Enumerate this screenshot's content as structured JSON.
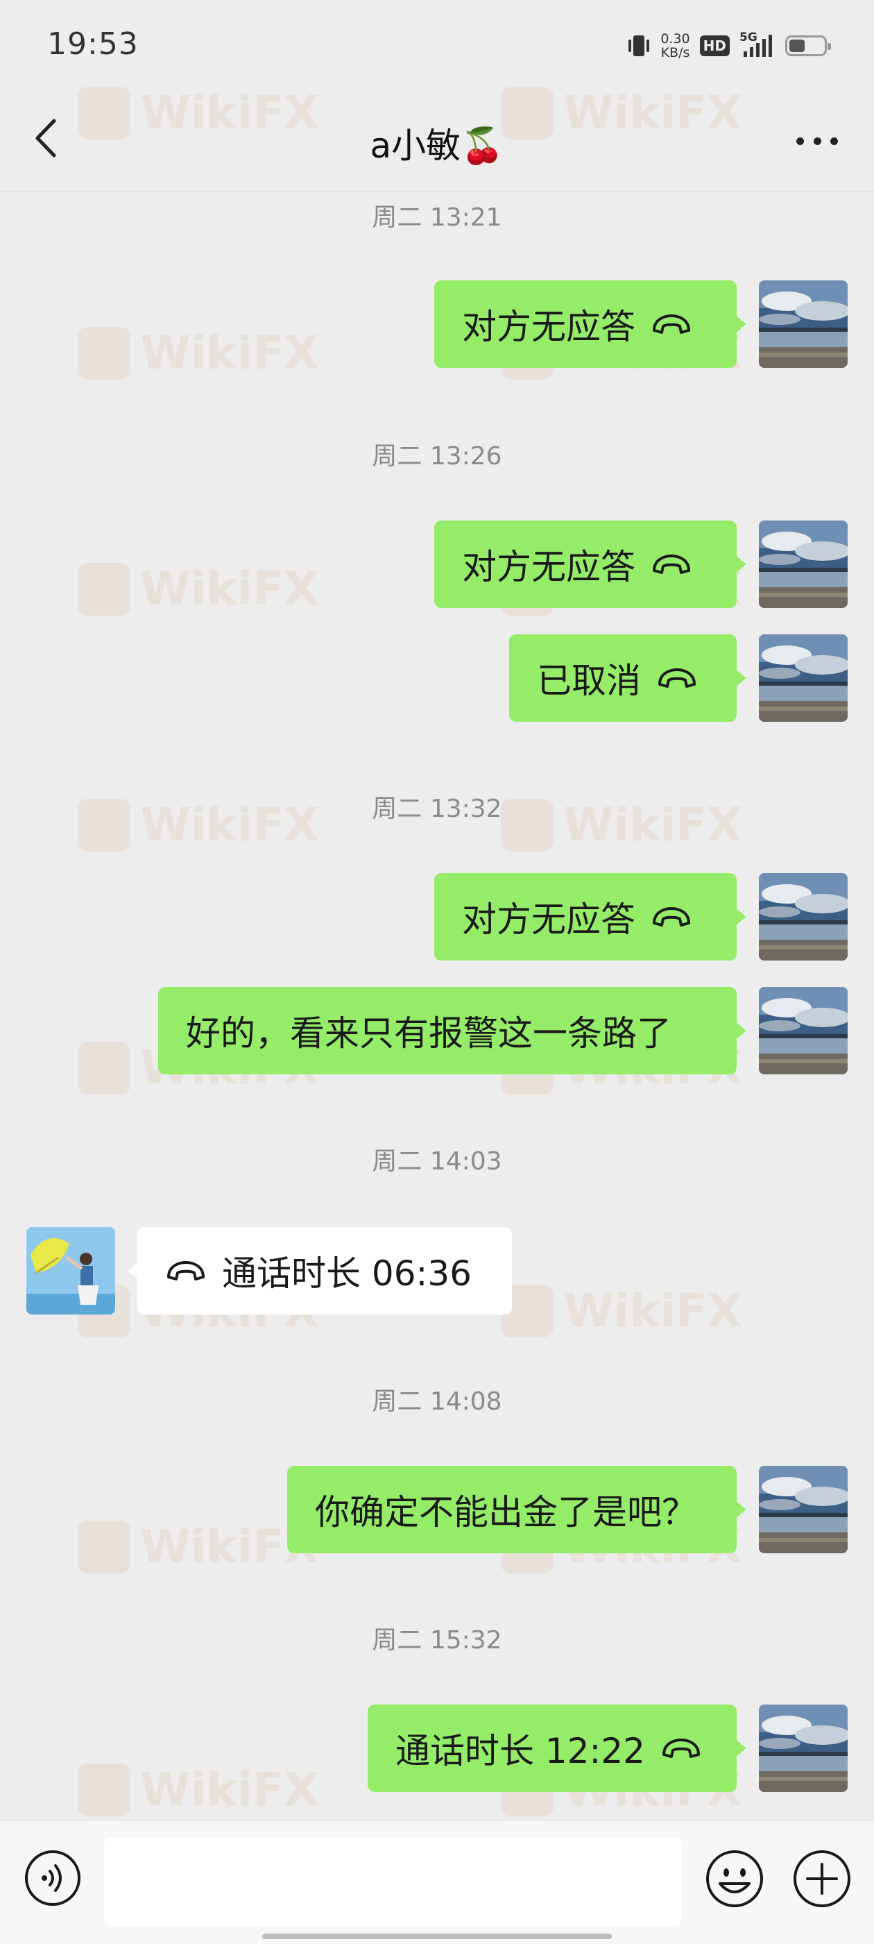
{
  "status_bar": {
    "time": "19:53",
    "net_speed_value": "0.30",
    "net_speed_unit": "KB/s",
    "hd_badge": "HD",
    "network_type": "5G"
  },
  "header": {
    "contact_name": "a小敏🍒"
  },
  "watermark": "WikiFX",
  "messages": [
    {
      "type": "timestamp",
      "text": "周二 13:21"
    },
    {
      "type": "outgoing",
      "text": "对方无应答",
      "icon": "phone-hangup-icon"
    },
    {
      "type": "timestamp",
      "text": "周二 13:26"
    },
    {
      "type": "outgoing",
      "text": "对方无应答",
      "icon": "phone-hangup-icon"
    },
    {
      "type": "outgoing",
      "text": "已取消",
      "icon": "phone-hangup-icon"
    },
    {
      "type": "timestamp",
      "text": "周二 13:32"
    },
    {
      "type": "outgoing",
      "text": "对方无应答",
      "icon": "phone-hangup-icon"
    },
    {
      "type": "outgoing",
      "text": "好的，看来只有报警这一条路了"
    },
    {
      "type": "timestamp",
      "text": "周二 14:03"
    },
    {
      "type": "incoming",
      "text": "通话时长 06:36",
      "icon": "phone-hangup-icon"
    },
    {
      "type": "timestamp",
      "text": "周二 14:08"
    },
    {
      "type": "outgoing",
      "text": "你确定不能出金了是吧？"
    },
    {
      "type": "timestamp",
      "text": "周二 15:32"
    },
    {
      "type": "outgoing",
      "text": "通话时长 12:22",
      "icon": "phone-hangup-icon"
    }
  ],
  "input_bar": {
    "placeholder": "",
    "voice_icon": "voice-icon",
    "emoji_icon": "emoji-icon",
    "plus_icon": "plus-icon"
  },
  "colors": {
    "background": "#ededed",
    "outgoing_bubble": "#95ec69",
    "incoming_bubble": "#ffffff",
    "timestamp_text": "#8a8a8a"
  }
}
